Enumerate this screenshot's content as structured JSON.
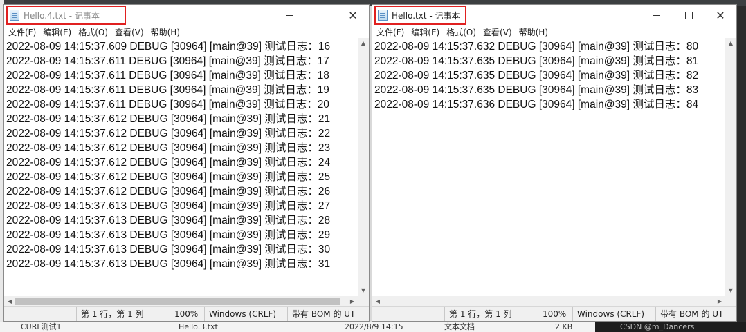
{
  "desktop": {
    "bottom_file_name": "Hello.3.txt",
    "bottom_date": "2022/8/9 14:15",
    "bottom_type": "文本文档",
    "bottom_size": "2 KB",
    "bottom_left_label": "CURL测试1",
    "watermark": "CSDN @m_Dancers"
  },
  "windows": [
    {
      "title": "Hello.4.txt - 记事本",
      "menu": [
        "文件(F)",
        "编辑(E)",
        "格式(O)",
        "查看(V)",
        "帮助(H)"
      ],
      "lines": [
        "2022-08-09 14:15:37.609 DEBUG [30964] [main@39] 测试日志：16",
        "2022-08-09 14:15:37.611 DEBUG [30964] [main@39] 测试日志：17",
        "2022-08-09 14:15:37.611 DEBUG [30964] [main@39] 测试日志：18",
        "2022-08-09 14:15:37.611 DEBUG [30964] [main@39] 测试日志：19",
        "2022-08-09 14:15:37.611 DEBUG [30964] [main@39] 测试日志：20",
        "2022-08-09 14:15:37.612 DEBUG [30964] [main@39] 测试日志：21",
        "2022-08-09 14:15:37.612 DEBUG [30964] [main@39] 测试日志：22",
        "2022-08-09 14:15:37.612 DEBUG [30964] [main@39] 测试日志：23",
        "2022-08-09 14:15:37.612 DEBUG [30964] [main@39] 测试日志：24",
        "2022-08-09 14:15:37.612 DEBUG [30964] [main@39] 测试日志：25",
        "2022-08-09 14:15:37.612 DEBUG [30964] [main@39] 测试日志：26",
        "2022-08-09 14:15:37.613 DEBUG [30964] [main@39] 测试日志：27",
        "2022-08-09 14:15:37.613 DEBUG [30964] [main@39] 测试日志：28",
        "2022-08-09 14:15:37.613 DEBUG [30964] [main@39] 测试日志：29",
        "2022-08-09 14:15:37.613 DEBUG [30964] [main@39] 测试日志：30",
        "2022-08-09 14:15:37.613 DEBUG [30964] [main@39] 测试日志：31"
      ],
      "status": {
        "position": "第 1 行，第 1 列",
        "zoom": "100%",
        "line_ending": "Windows (CRLF)",
        "encoding": "带有 BOM 的 UT"
      }
    },
    {
      "title": "Hello.txt - 记事本",
      "menu": [
        "文件(F)",
        "编辑(E)",
        "格式(O)",
        "查看(V)",
        "帮助(H)"
      ],
      "lines": [
        "2022-08-09 14:15:37.632 DEBUG [30964] [main@39] 测试日志：80",
        "2022-08-09 14:15:37.635 DEBUG [30964] [main@39] 测试日志：81",
        "2022-08-09 14:15:37.635 DEBUG [30964] [main@39] 测试日志：82",
        "2022-08-09 14:15:37.635 DEBUG [30964] [main@39] 测试日志：83",
        "2022-08-09 14:15:37.636 DEBUG [30964] [main@39] 测试日志：84"
      ],
      "status": {
        "position": "第 1 行，第 1 列",
        "zoom": "100%",
        "line_ending": "Windows (CRLF)",
        "encoding": "带有 BOM 的 UT"
      }
    }
  ],
  "colors": {
    "highlight": "#e02020"
  }
}
